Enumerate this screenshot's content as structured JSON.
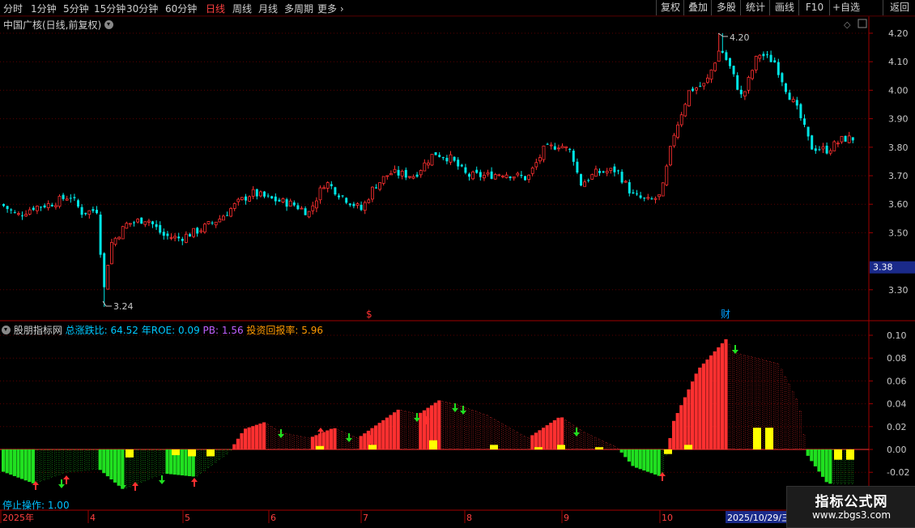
{
  "toolbar": {
    "left_items": [
      "分时",
      "1分钟",
      "5分钟",
      "15分钟",
      "30分钟",
      "60分钟",
      "日线",
      "周线",
      "月线",
      "多周期"
    ],
    "more_label": "更多",
    "right_items": [
      "复权",
      "叠加",
      "多股",
      "统计",
      "画线",
      "F10",
      "+自选",
      "返回"
    ]
  },
  "upper": {
    "title": "中国广核(日线,前复权)",
    "price_ticks": [
      "4.20",
      "4.10",
      "4.00",
      "3.90",
      "3.80",
      "3.70",
      "3.60",
      "3.50",
      "3.30"
    ],
    "current_price": "3.38",
    "high_label": "4.20",
    "low_label": "3.24",
    "marker_s": "$",
    "marker_cai": "财"
  },
  "lower": {
    "indicator_name": "股朋指标网",
    "zzdb_label": "总涨跌比:",
    "zzdb_value": "64.52",
    "roe_label": "年ROE:",
    "roe_value": "0.09",
    "pb_label": "PB:",
    "pb_value": "1.56",
    "tzhbl_label": "投资回报率:",
    "tzhbl_value": "5.96",
    "ticks": [
      "0.10",
      "0.08",
      "0.06",
      "0.04",
      "0.02",
      "0.00",
      "-0.02"
    ],
    "stop_label": "停止操作: 1.00"
  },
  "date_axis": [
    "2025年",
    "4",
    "5",
    "6",
    "7",
    "8",
    "9",
    "10"
  ],
  "cursor_date": "2025/10/29/三",
  "watermark": {
    "line1": "指标公式网",
    "line2": "www.zbgs3.com"
  },
  "colors": {
    "up": "#ff3030",
    "down": "#00e5e5",
    "green": "#20e020",
    "yellow": "#ffff00",
    "axis": "#a00000"
  }
}
